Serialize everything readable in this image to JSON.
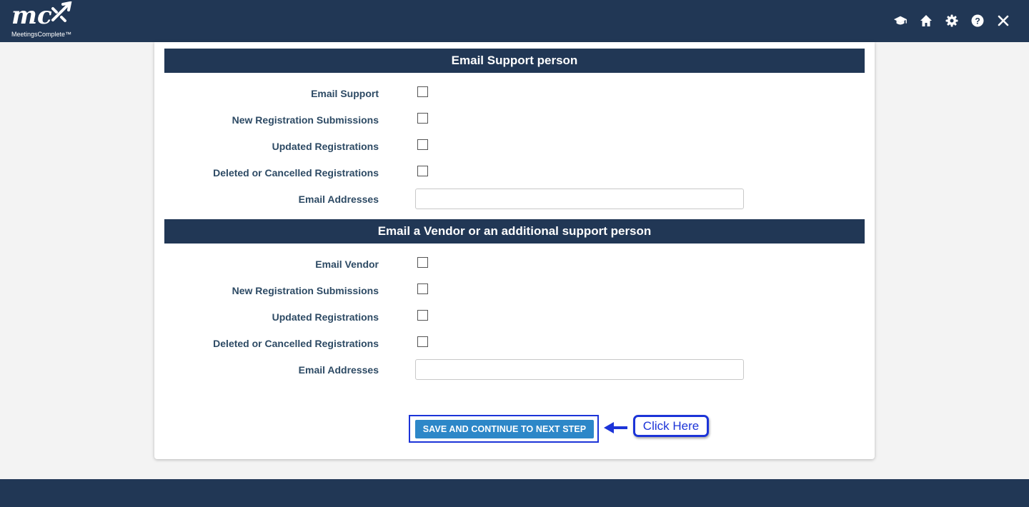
{
  "header": {
    "logo_mark": "mc",
    "logo_text": "MeetingsComplete™",
    "icons": [
      "graduation-cap-icon",
      "home-icon",
      "gear-icon",
      "help-icon",
      "close-icon"
    ]
  },
  "sections": [
    {
      "title": "Email Support person",
      "checkbox_rows": [
        {
          "label": "Email Support",
          "checked": false
        },
        {
          "label": "New Registration Submissions",
          "checked": false
        },
        {
          "label": "Updated Registrations",
          "checked": false
        },
        {
          "label": "Deleted or Cancelled Registrations",
          "checked": false
        }
      ],
      "email_label": "Email Addresses",
      "email_value": "",
      "email_placeholder": ""
    },
    {
      "title": "Email a Vendor or an additional support person",
      "checkbox_rows": [
        {
          "label": "Email Vendor",
          "checked": false
        },
        {
          "label": "New Registration Submissions",
          "checked": false
        },
        {
          "label": "Updated Registrations",
          "checked": false
        },
        {
          "label": "Deleted or Cancelled Registrations",
          "checked": false
        }
      ],
      "email_label": "Email Addresses",
      "email_value": "",
      "email_placeholder": ""
    }
  ],
  "actions": {
    "save_label": "SAVE AND CONTINUE TO NEXT STEP",
    "callout_label": "Click Here"
  },
  "colors": {
    "navy": "#213755",
    "button_blue": "#2d87c8",
    "highlight_blue": "#1c34d8"
  }
}
